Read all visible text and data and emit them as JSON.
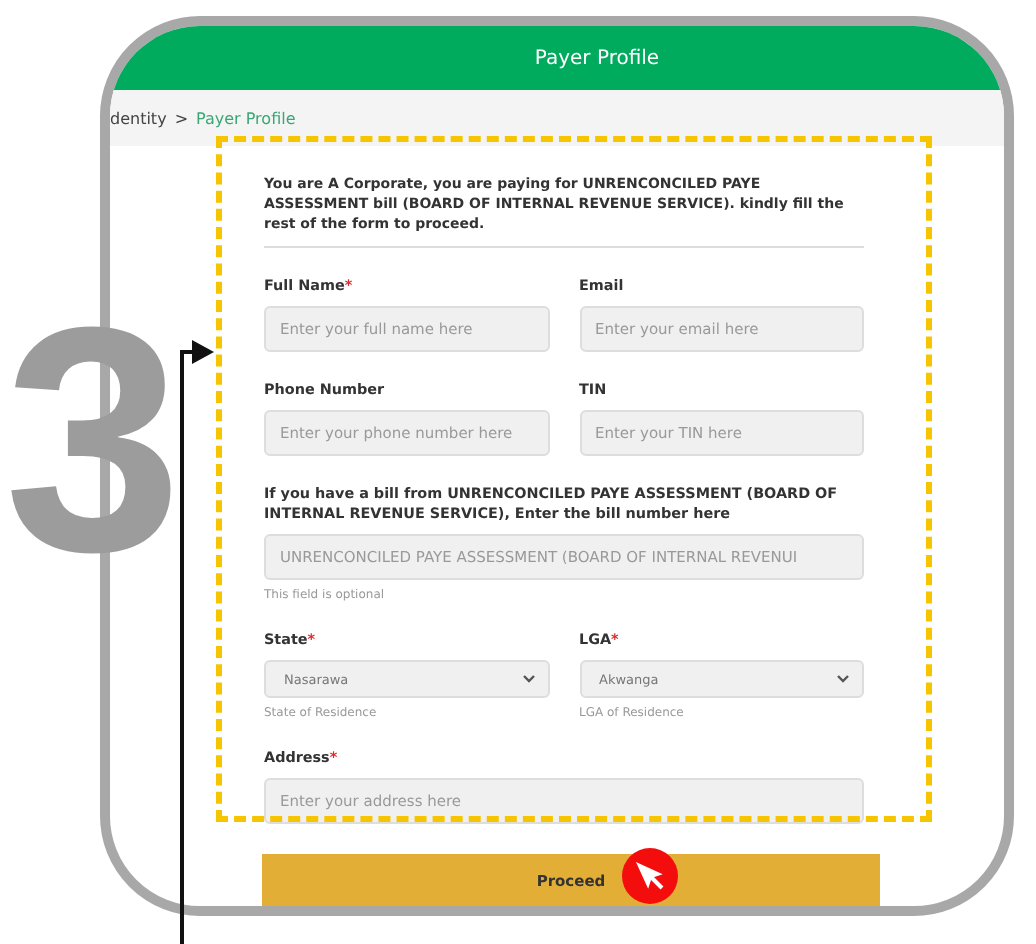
{
  "step_number": "3",
  "header": {
    "title": "Payer Profile"
  },
  "breadcrumb": {
    "items": [
      {
        "label": "dentity",
        "current": false
      },
      {
        "label": "Payer Profile",
        "current": true
      }
    ],
    "separator": ">"
  },
  "intro": "You are A Corporate, you are paying for UNRENCONCILED PAYE ASSESSMENT bill (BOARD OF INTERNAL REVENUE SERVICE). kindly fill the rest of the form to proceed.",
  "rows": [
    [
      {
        "kind": "text",
        "label": "Full Name",
        "required_mark": "*",
        "placeholder": "Enter your full name here"
      },
      {
        "kind": "text",
        "label": "Email",
        "placeholder": "Enter your email here"
      }
    ],
    [
      {
        "kind": "text",
        "label": "Phone Number",
        "placeholder": "Enter your phone number here"
      },
      {
        "kind": "text",
        "label": "TIN",
        "placeholder": "Enter your TIN here"
      }
    ],
    [
      {
        "kind": "text",
        "label": "If you have a bill from UNRENCONCILED PAYE ASSESSMENT (BOARD OF INTERNAL REVENUE SERVICE), Enter the bill number here",
        "placeholder": "UNRENCONCILED PAYE ASSESSMENT (BOARD OF INTERNAL REVENUI",
        "hint": "This field is optional"
      }
    ],
    [
      {
        "kind": "select",
        "label": "State",
        "required_mark": "*",
        "value": "Nasarawa",
        "hint": "State of Residence"
      },
      {
        "kind": "select",
        "label": "LGA",
        "required_mark": "*",
        "value": "Akwanga",
        "hint": "LGA of Residence"
      }
    ],
    [
      {
        "kind": "text",
        "label": "Address",
        "required_mark": "*",
        "placeholder": "Enter your address here"
      }
    ]
  ],
  "submit": {
    "label": "Proceed"
  }
}
